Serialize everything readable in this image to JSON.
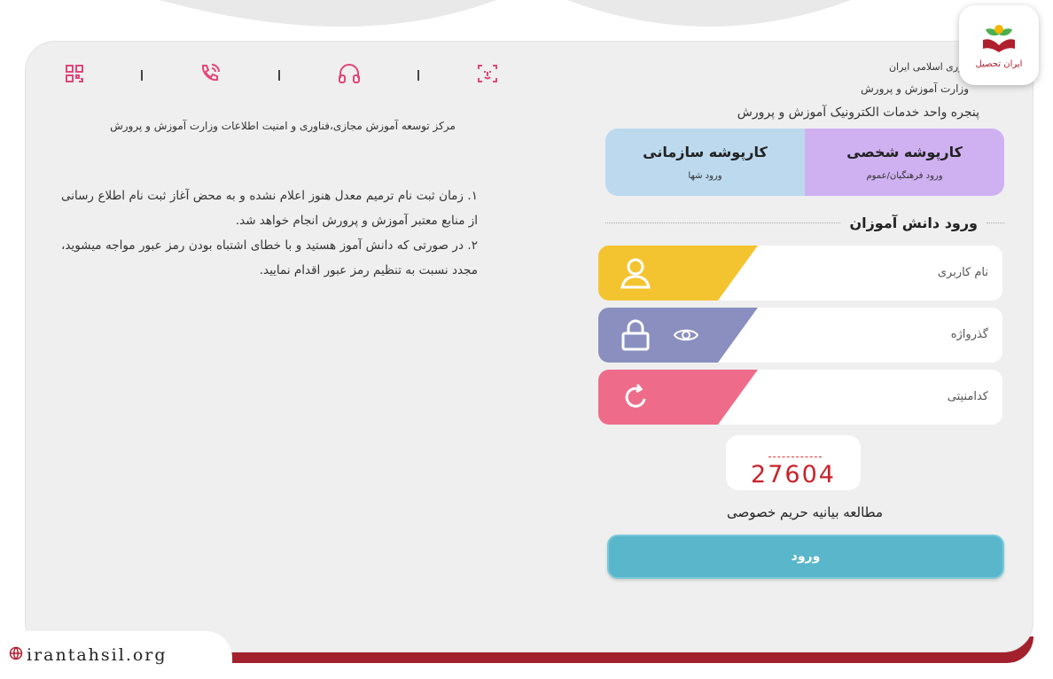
{
  "logo": {
    "text": "ایران تحصیل"
  },
  "header": {
    "line1": "جمهوری اسلامی ایران",
    "line2": "وزارت آموزش و پرورش",
    "line3": "پنجره واحد خدمات الکترونیک آموزش و پرورش"
  },
  "tabs": [
    {
      "title": "کارپوشه شخصی",
      "sub": "ورود فرهنگیان/عموم",
      "color": "#cfb1f2"
    },
    {
      "title": "کارپوشه سازمانی",
      "sub": "ورود شها",
      "color": "#bcd9ee"
    }
  ],
  "login": {
    "section_title": "ورود دانش آموزان",
    "username_label": "نام کاربری",
    "password_label": "گذرواژه",
    "captcha_label": "کدامنیتی",
    "captcha_value": "27604",
    "privacy_link": "مطالعه بیانیه حریم خصوصی",
    "submit_label": "ورود"
  },
  "left_panel": {
    "icons": [
      "qr-code-icon",
      "phone-icon",
      "headset-icon",
      "face-id-icon"
    ],
    "org_title": "مرکز توسعه آموزش مجازی،فناوری و امنیت اطلاعات وزارت آموزش و پرورش",
    "notes": [
      "۱. زمان ثبت نام ترمیم معدل هنوز اعلام نشده و به محض آغاز ثبت نام اطلاع رسانی از منابع معتبر آموزش و پرورش انجام خواهد شد.",
      "۲. در صورتی که دانش آموز هستید و با خطای اشتباه بودن رمز عبور مواجه میشوید، مجدد نسبت به تنظیم رمز عبور اقدام نمایید."
    ]
  },
  "watermark": {
    "site": "irantahsil.org"
  },
  "colors": {
    "user_accent": "#f4c430",
    "password_accent": "#8a8fbf",
    "captcha_accent": "#ee6c8a",
    "button": "#5ab6cb",
    "brand_red": "#a3202d",
    "icon_pink": "#e2457a"
  }
}
